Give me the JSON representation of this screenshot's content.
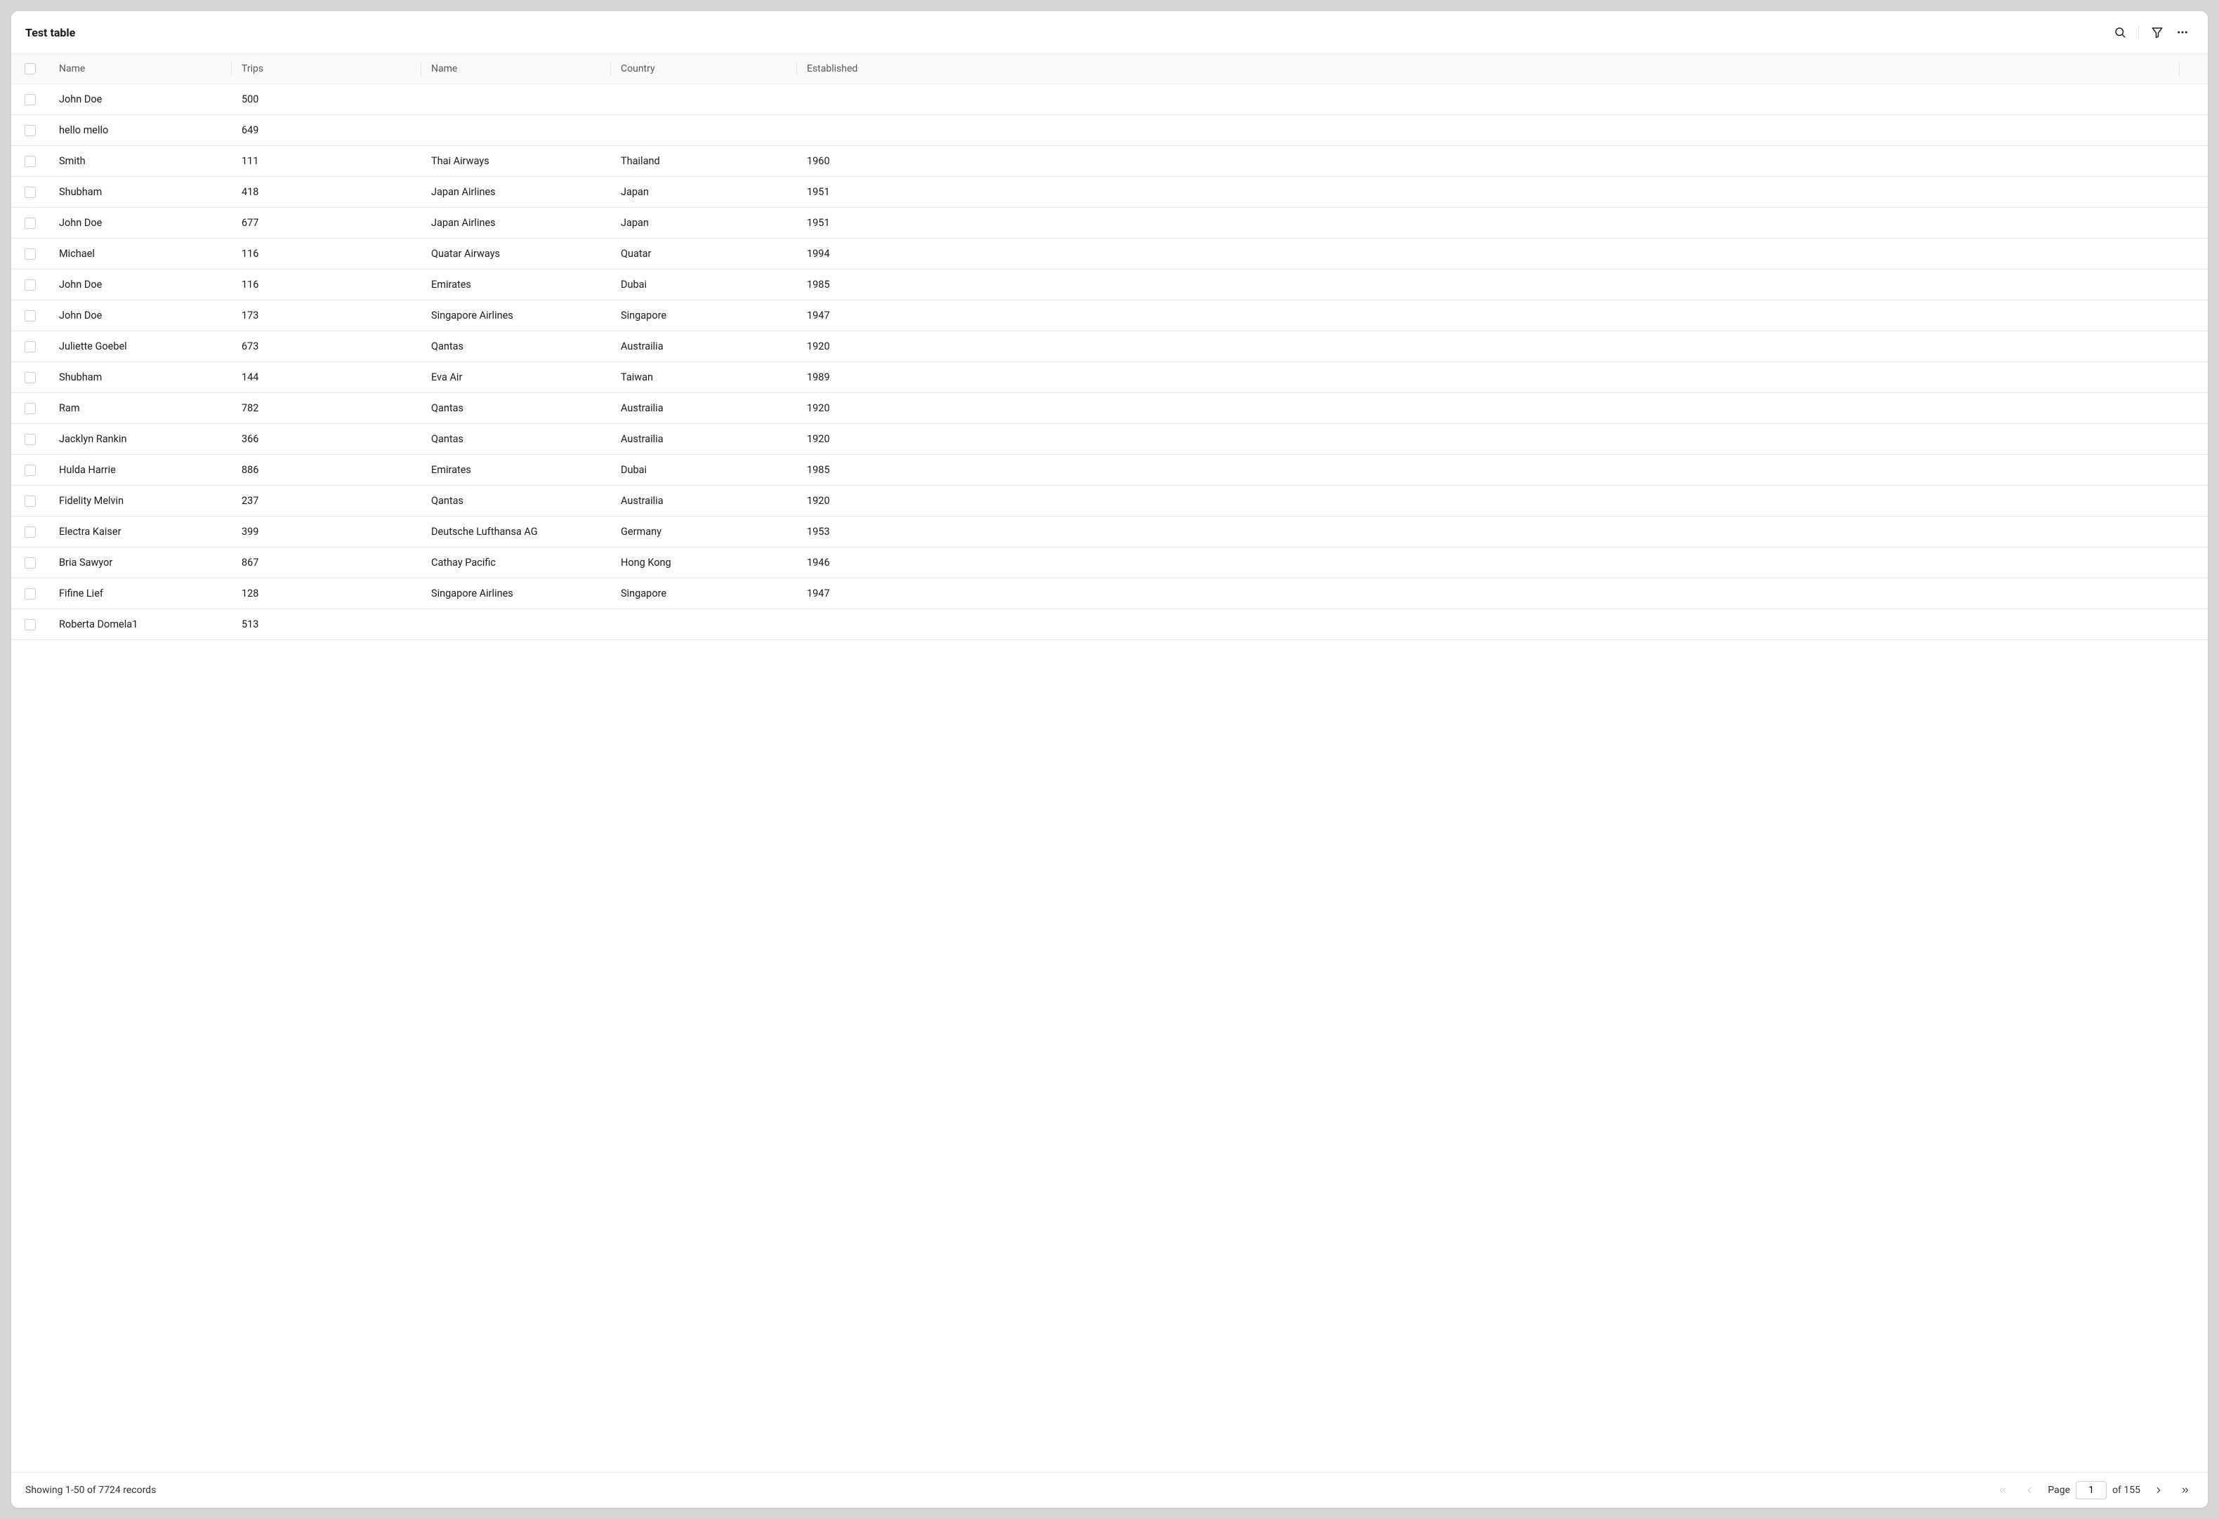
{
  "title": "Test table",
  "columns": {
    "name1": "Name",
    "trips": "Trips",
    "name2": "Name",
    "country": "Country",
    "established": "Established"
  },
  "rows": [
    {
      "name": "John Doe",
      "trips": "500",
      "airline": "",
      "country": "",
      "established": ""
    },
    {
      "name": "hello mello",
      "trips": "649",
      "airline": "",
      "country": "",
      "established": ""
    },
    {
      "name": "Smith",
      "trips": "111",
      "airline": "Thai Airways",
      "country": "Thailand",
      "established": "1960"
    },
    {
      "name": "Shubham",
      "trips": "418",
      "airline": "Japan Airlines",
      "country": "Japan",
      "established": "1951"
    },
    {
      "name": "John Doe",
      "trips": "677",
      "airline": "Japan Airlines",
      "country": "Japan",
      "established": "1951"
    },
    {
      "name": "Michael",
      "trips": "116",
      "airline": "Quatar Airways",
      "country": "Quatar",
      "established": "1994"
    },
    {
      "name": "John Doe",
      "trips": "116",
      "airline": "Emirates",
      "country": "Dubai",
      "established": "1985"
    },
    {
      "name": "John Doe",
      "trips": "173",
      "airline": "Singapore Airlines",
      "country": "Singapore",
      "established": "1947"
    },
    {
      "name": "Juliette Goebel",
      "trips": "673",
      "airline": "Qantas",
      "country": "Austrailia",
      "established": "1920"
    },
    {
      "name": "Shubham",
      "trips": "144",
      "airline": "Eva Air",
      "country": "Taiwan",
      "established": "1989"
    },
    {
      "name": "Ram",
      "trips": "782",
      "airline": "Qantas",
      "country": "Austrailia",
      "established": "1920"
    },
    {
      "name": "Jacklyn Rankin",
      "trips": "366",
      "airline": "Qantas",
      "country": "Austrailia",
      "established": "1920"
    },
    {
      "name": "Hulda Harrie",
      "trips": "886",
      "airline": "Emirates",
      "country": "Dubai",
      "established": "1985"
    },
    {
      "name": "Fidelity Melvin",
      "trips": "237",
      "airline": "Qantas",
      "country": "Austrailia",
      "established": "1920"
    },
    {
      "name": "Electra Kaiser",
      "trips": "399",
      "airline": "Deutsche Lufthansa AG",
      "country": "Germany",
      "established": "1953"
    },
    {
      "name": "Bria Sawyor",
      "trips": "867",
      "airline": "Cathay Pacific",
      "country": "Hong Kong",
      "established": "1946"
    },
    {
      "name": "Fifine Lief",
      "trips": "128",
      "airline": "Singapore Airlines",
      "country": "Singapore",
      "established": "1947"
    },
    {
      "name": "Roberta Domela1",
      "trips": "513",
      "airline": "",
      "country": "",
      "established": ""
    }
  ],
  "footer": {
    "status": "Showing 1-50 of 7724 records",
    "page_label": "Page",
    "page_value": "1",
    "total_pages": "of 155"
  }
}
